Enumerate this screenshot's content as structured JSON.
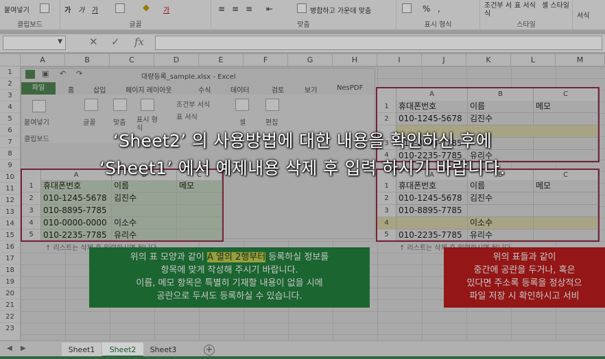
{
  "ribbon": {
    "groups": [
      {
        "label": "클립보드",
        "items": [
          "붙여넣기"
        ]
      },
      {
        "label": "글꼴",
        "items": [
          "가",
          "가",
          "가",
          "가"
        ]
      },
      {
        "label": "맞춤",
        "items": [
          "병합하고 가운데 맞춤"
        ]
      },
      {
        "label": "표시 형식",
        "items": [
          "%",
          ","
        ]
      },
      {
        "label": "스타일",
        "items": [
          "조건부 서식",
          "표 서식",
          "셀 스타일"
        ]
      },
      {
        "label": "셀",
        "items": [
          "서식"
        ]
      }
    ]
  },
  "formula_bar": {
    "fx": "fx",
    "cancel": "✕",
    "confirm": "✓"
  },
  "columns": [
    "A",
    "B",
    "C",
    "D",
    "E",
    "F",
    "G",
    "H",
    "I",
    "J",
    "K",
    "L",
    "M"
  ],
  "rows": [
    "1",
    "2",
    "3",
    "4",
    "5",
    "6",
    "7",
    "8",
    "9",
    "10",
    "11",
    "12",
    "13",
    "14",
    "15",
    "16",
    "17",
    "18",
    "19",
    "20",
    "21",
    "22",
    "23"
  ],
  "inner_excel": {
    "filename": "대량등록_sample.xlsx - Excel",
    "tabs": [
      "파일",
      "홈",
      "삽입",
      "페이지 레이아웃",
      "수식",
      "데이터",
      "검토",
      "보기",
      "NesPDF"
    ],
    "toolbar_labels": [
      "붙여넣기",
      "글꼴",
      "맞춤",
      "표시 형식",
      "조건부 서식",
      "표 서식",
      "셀",
      "편집",
      "클립보드"
    ]
  },
  "table_left": {
    "cols": [
      "A",
      "B",
      "C"
    ],
    "rows": [
      {
        "row": "1",
        "cells": [
          "휴대폰번호",
          "이름",
          "메모"
        ]
      },
      {
        "row": "2",
        "cells": [
          "010-1245-5678",
          "김진수",
          ""
        ]
      },
      {
        "row": "3",
        "cells": [
          "010-8895-7785",
          "",
          ""
        ]
      },
      {
        "row": "4",
        "cells": [
          "010-0000-0000",
          "이소수",
          ""
        ]
      },
      {
        "row": "5",
        "cells": [
          "010-2235-7785",
          "유리수",
          ""
        ]
      }
    ]
  },
  "table_right_top": {
    "cols": [
      "A",
      "B",
      "C"
    ],
    "rows": [
      {
        "row": "1",
        "cells": [
          "휴대폰번호",
          "이름",
          "메모"
        ]
      },
      {
        "row": "2",
        "cells": [
          "010-1245-5678",
          "김진수",
          ""
        ]
      },
      {
        "row": "3",
        "cells": [
          "010-8895-7785",
          "",
          ""
        ]
      },
      {
        "row": "4",
        "cells": [
          "010-2235-7785",
          "유리수",
          ""
        ]
      }
    ]
  },
  "table_right_bottom": {
    "cols": [
      "A",
      "B",
      "C"
    ],
    "rows": [
      {
        "row": "1",
        "cells": [
          "휴대폰번호",
          "이름",
          "메모"
        ]
      },
      {
        "row": "2",
        "cells": [
          "010-1245-5678",
          "김진수",
          ""
        ]
      },
      {
        "row": "3",
        "cells": [
          "010-8895-7785",
          "",
          ""
        ]
      },
      {
        "row": "4",
        "cells": [
          "",
          "이소수",
          ""
        ]
      },
      {
        "row": "5",
        "cells": [
          "010-2235-7785",
          "유리수",
          ""
        ]
      }
    ]
  },
  "notes": {
    "left": "↑ 리스트는 삭제 후 입력하시면 됩니다.",
    "right": "↑ 리스트는 삭제 후 입력하시면 됩니다."
  },
  "green_box": {
    "line1_pre": "위의 표 모양과 같이 ",
    "line1_hl": "A 열의 2행부터",
    "line1_post": " 등록하실 정보를",
    "line2": "항목에 맞게 작성해 주시기 바랍니다.",
    "line3": "이름, 메모 항목은 특별히 기재할 내용이 없을 시에",
    "line4": "공란으로 두셔도 등록하실 수 있습니다."
  },
  "red_box": {
    "line1": "위의 표들과 같이",
    "line2": "중간에 공란을 두거나, 혹은",
    "line3": "있다면 주소록 등록을 정상적으",
    "line4": "파일 저장 시 확인하시고 서비"
  },
  "sheet_tabs": [
    "Sheet1",
    "Sheet2",
    "Sheet3"
  ],
  "overlay": {
    "line1": "‘Sheet2’ 의 사용방법에 대한 내용을 확인하신 후에",
    "line2": "‘Sheet1’ 에서 예제내용 삭제 후 입력 하시기 바랍니다."
  },
  "colors": {
    "green_box": "#217c3c",
    "red_box": "#b51c1c",
    "table_border": "#8e2a45",
    "active_tab": "#2a8a4a"
  }
}
